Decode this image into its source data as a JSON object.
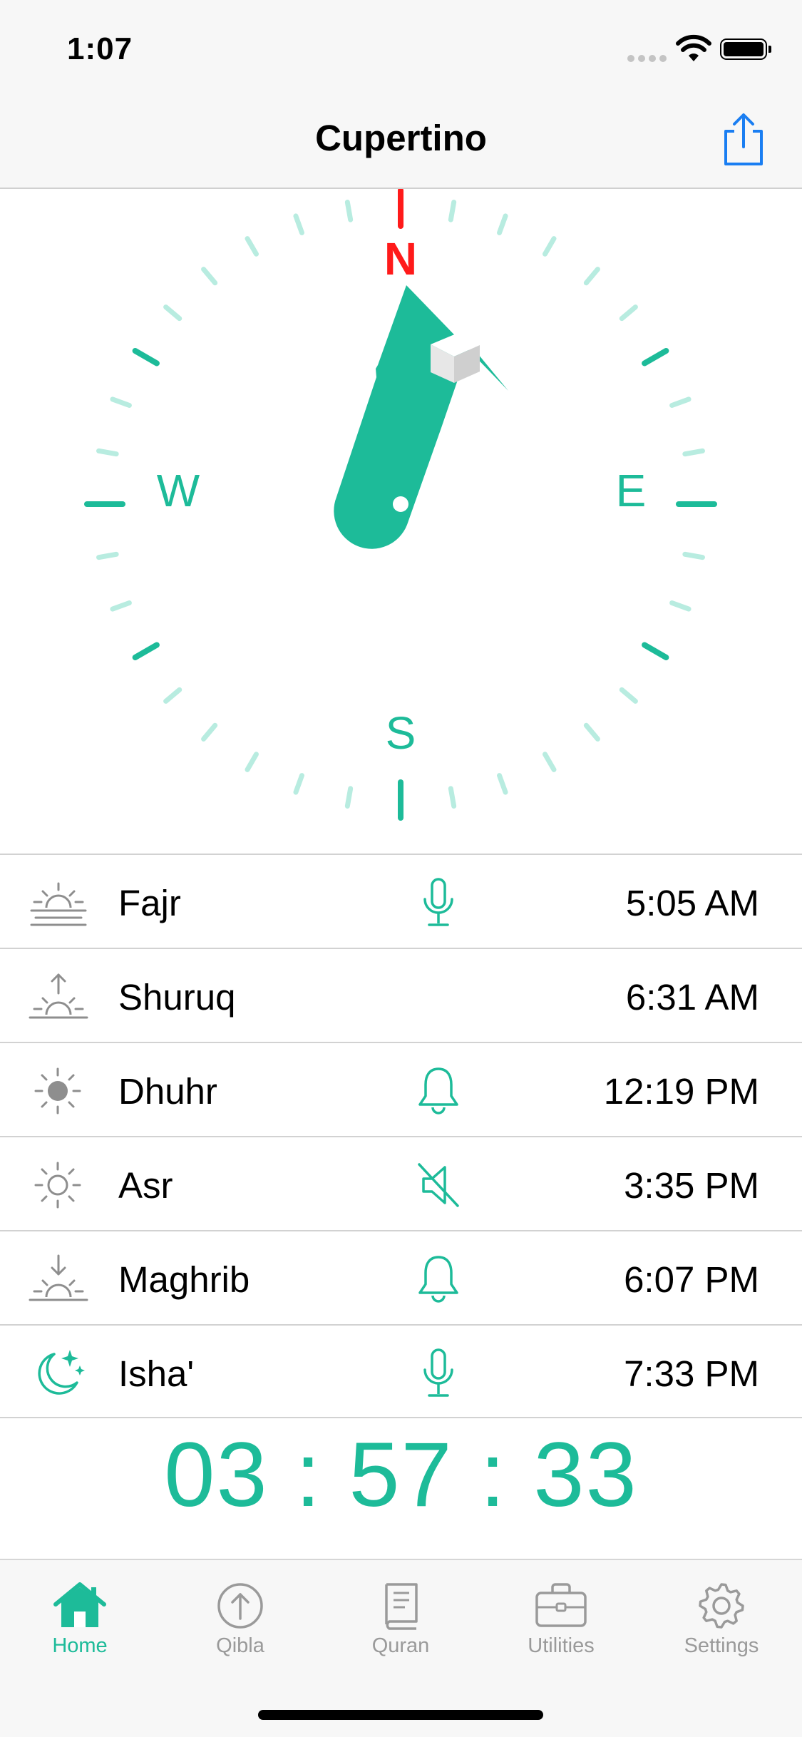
{
  "status_bar": {
    "time": "1:07"
  },
  "nav": {
    "title": "Cupertino",
    "share_icon": "share-icon"
  },
  "compass": {
    "north": "N",
    "south": "S",
    "east": "E",
    "west": "W",
    "accent_color": "#1dbb99",
    "north_color": "#ff1a1a",
    "tick_color": "#b8ece0"
  },
  "prayers": [
    {
      "name": "Fajr",
      "time": "5:05 AM",
      "icon": "sunrise-horizon-icon",
      "alert": "microphone-icon"
    },
    {
      "name": "Shuruq",
      "time": "6:31 AM",
      "icon": "sunrise-up-arrow-icon",
      "alert": ""
    },
    {
      "name": "Dhuhr",
      "time": "12:19 PM",
      "icon": "sun-filled-icon",
      "alert": "bell-icon"
    },
    {
      "name": "Asr",
      "time": "3:35 PM",
      "icon": "sun-outline-icon",
      "alert": "muted-speaker-icon"
    },
    {
      "name": "Maghrib",
      "time": "6:07 PM",
      "icon": "sunset-down-arrow-icon",
      "alert": "bell-icon"
    },
    {
      "name": "Isha'",
      "time": "7:33 PM",
      "icon": "moon-stars-icon",
      "alert": "microphone-icon"
    }
  ],
  "countdown": "03 : 57 : 33",
  "tabs": [
    {
      "label": "Home",
      "icon": "home-icon",
      "active": true
    },
    {
      "label": "Qibla",
      "icon": "qibla-arrow-icon",
      "active": false
    },
    {
      "label": "Quran",
      "icon": "book-icon",
      "active": false
    },
    {
      "label": "Utilities",
      "icon": "briefcase-icon",
      "active": false
    },
    {
      "label": "Settings",
      "icon": "gear-icon",
      "active": false
    }
  ]
}
